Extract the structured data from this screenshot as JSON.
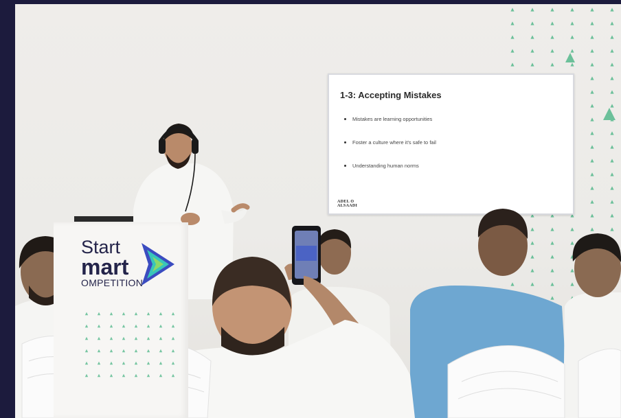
{
  "slide": {
    "title": "1-3: Accepting Mistakes",
    "bullets": [
      "Mistakes are learning opportunities",
      "Foster a culture where it's safe to fail",
      "Understanding human norms"
    ],
    "logo_line1": "ADEL O",
    "logo_line2": "ALSAADI"
  },
  "podium_sign": {
    "line1": "Start",
    "line2": "mart",
    "line3": "OMPETITION"
  },
  "colors": {
    "frame": "#1c1b3d",
    "wall": "#eeece9",
    "triangle_accent": "#4fb38a",
    "brand_navy": "#24244a",
    "logo_blue": "#3b4cc0",
    "logo_teal": "#39c6b9",
    "logo_green": "#8bd96a"
  }
}
